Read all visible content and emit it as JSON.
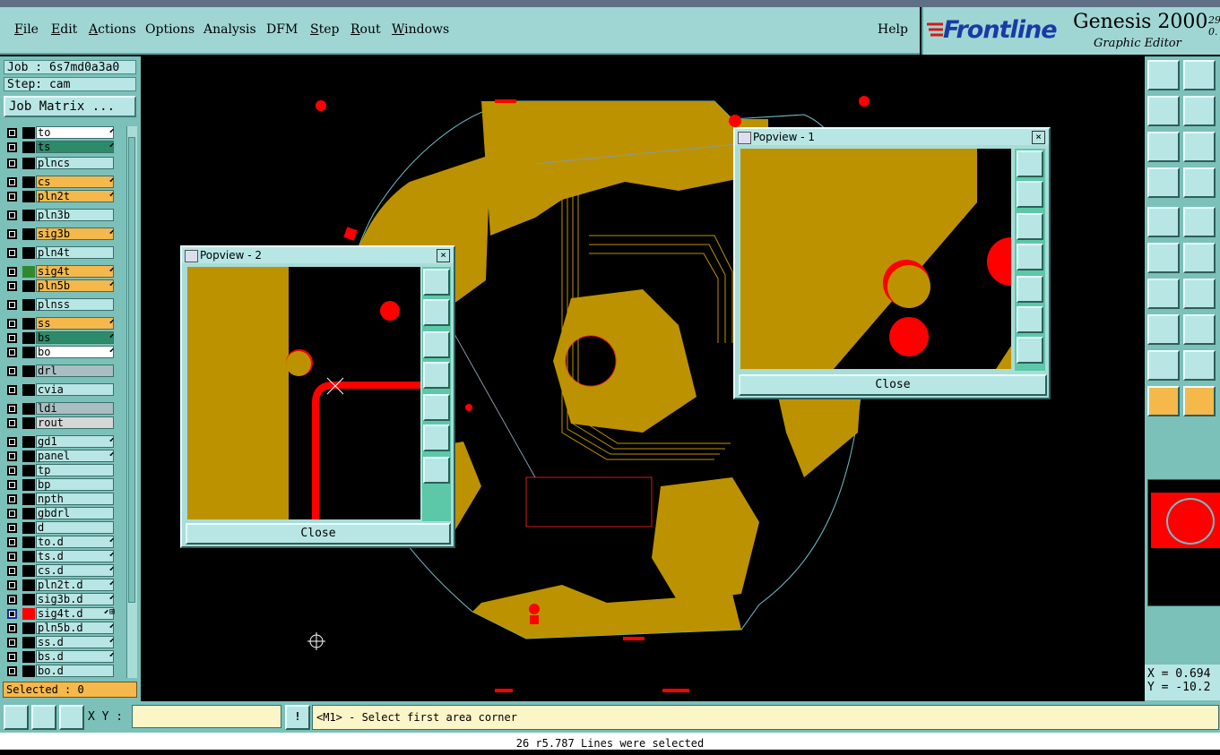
{
  "menu": [
    "File",
    "Edit",
    "Actions",
    "Options",
    "Analysis",
    "DFM",
    "Step",
    "Rout",
    "Windows"
  ],
  "help": "Help",
  "logo": {
    "brand": "Frontline",
    "product": "Genesis 2000",
    "subtitle": "Graphic Editor",
    "version": "29 0."
  },
  "job": {
    "job": "Job : 6s7md0a3a0",
    "step": "Step: cam",
    "matrix": "Job Matrix ..."
  },
  "layers": [
    {
      "name": "to",
      "color": "#ffffff",
      "mark": "⬋"
    },
    {
      "name": "ts",
      "color": "#2e8b6a",
      "mark": "⬋"
    },
    {
      "name": "plncs",
      "color": "#b8e6e4",
      "mark": ""
    },
    {
      "name": "cs",
      "color": "#f5b84a",
      "mark": "⬋"
    },
    {
      "name": "pln2t",
      "color": "#f5b84a",
      "mark": "⬋"
    },
    {
      "name": "pln3b",
      "color": "#b8e6e4",
      "mark": ""
    },
    {
      "name": "sig3b",
      "color": "#f5b84a",
      "mark": "⬋"
    },
    {
      "name": "pln4t",
      "color": "#b8e6e4",
      "mark": ""
    },
    {
      "name": "sig4t",
      "color": "#f5b84a",
      "mark": "⬋"
    },
    {
      "name": "pln5b",
      "color": "#f5b84a",
      "mark": "⬋"
    },
    {
      "name": "plnss",
      "color": "#b8e6e4",
      "mark": ""
    },
    {
      "name": "ss",
      "color": "#f5b84a",
      "mark": "⬋"
    },
    {
      "name": "bs",
      "color": "#2e8b6a",
      "mark": "⬋"
    },
    {
      "name": "bo",
      "color": "#ffffff",
      "mark": "⬋"
    },
    {
      "name": "drl",
      "color": "#a9bec2",
      "mark": ""
    },
    {
      "name": "cvia",
      "color": "#b8e6e4",
      "mark": ""
    },
    {
      "name": "ldi",
      "color": "#a9bec2",
      "mark": ""
    },
    {
      "name": "rout",
      "color": "#d6d6d6",
      "mark": ""
    },
    {
      "name": "gd1",
      "color": "#b8e6e4",
      "mark": "⬋"
    },
    {
      "name": "panel",
      "color": "#b8e6e4",
      "mark": "⬋"
    },
    {
      "name": "tp",
      "color": "#b8e6e4",
      "mark": ""
    },
    {
      "name": "bp",
      "color": "#b8e6e4",
      "mark": ""
    },
    {
      "name": "npth",
      "color": "#b8e6e4",
      "mark": ""
    },
    {
      "name": "gbdrl",
      "color": "#b8e6e4",
      "mark": ""
    },
    {
      "name": "d",
      "color": "#b8e6e4",
      "mark": ""
    },
    {
      "name": "to.d",
      "color": "#b8e6e4",
      "mark": "⬋"
    },
    {
      "name": "ts.d",
      "color": "#b8e6e4",
      "mark": "⬋"
    },
    {
      "name": "cs.d",
      "color": "#b8e6e4",
      "mark": "⬋"
    },
    {
      "name": "pln2t.d",
      "color": "#b8e6e4",
      "mark": "⬋"
    },
    {
      "name": "sig3b.d",
      "color": "#b8e6e4",
      "mark": "⬋"
    },
    {
      "name": "sig4t.d",
      "color": "#b8e6e4",
      "mark": "⬋⊞"
    },
    {
      "name": "pln5b.d",
      "color": "#b8e6e4",
      "mark": "⬋"
    },
    {
      "name": "ss.d",
      "color": "#b8e6e4",
      "mark": "⬋"
    },
    {
      "name": "bs.d",
      "color": "#b8e6e4",
      "mark": "⬋"
    },
    {
      "name": "bo.d",
      "color": "#b8e6e4",
      "mark": ""
    }
  ],
  "selected": "Selected : 0",
  "popview1": {
    "title": "Popview - 1",
    "close": "Close"
  },
  "popview2": {
    "title": "Popview - 2",
    "close": "Close"
  },
  "xy_label": "X Y :",
  "xy_value": "",
  "prompt": "<M1> - Select first area corner",
  "status": "26 r5.787 Lines were selected",
  "coords": {
    "x": "X = 0.694",
    "y": "Y = -10.2"
  },
  "colors": {
    "copper": "#bc9200",
    "pad": "#ff0000",
    "board_outline": "#6fc0c8"
  }
}
